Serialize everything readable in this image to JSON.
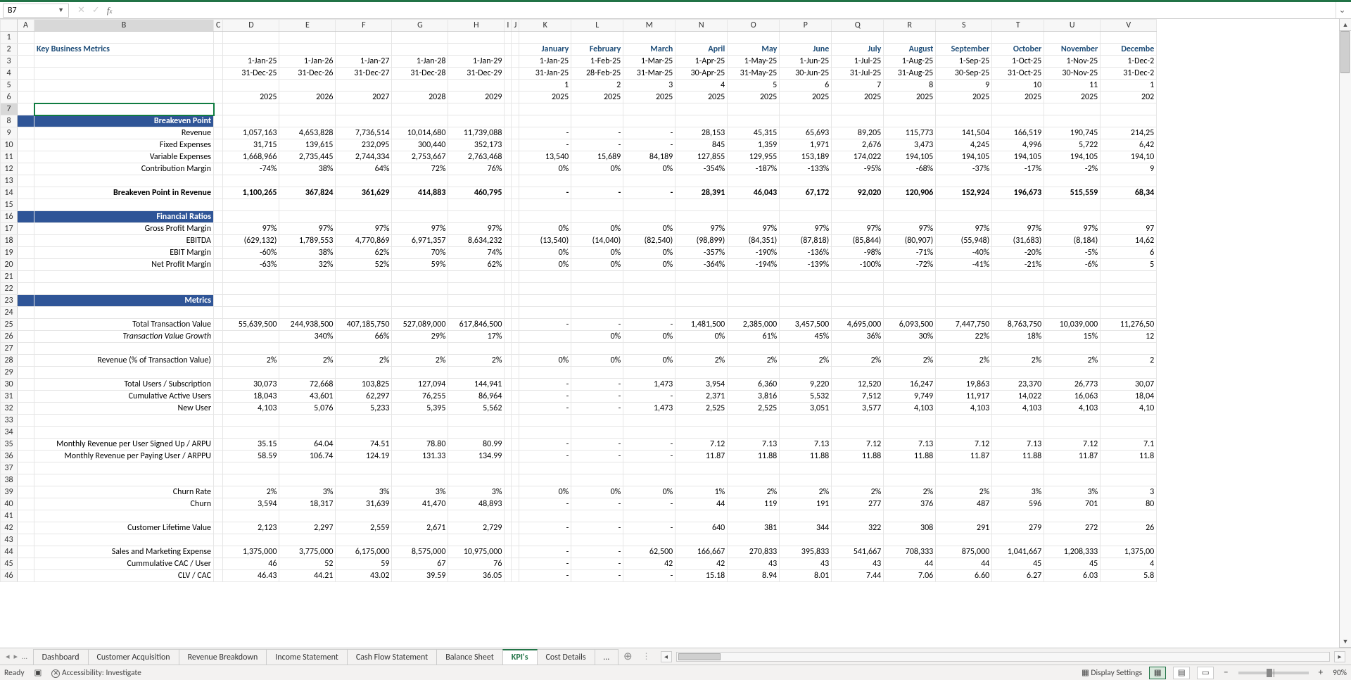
{
  "namebox": "B7",
  "columns": [
    "A",
    "B",
    "C",
    "D",
    "E",
    "F",
    "G",
    "H",
    "I",
    "J",
    "K",
    "L",
    "M",
    "N",
    "O",
    "P",
    "Q",
    "R",
    "S",
    "T",
    "U",
    "V"
  ],
  "colWidths": {
    "A": 24,
    "B": 255,
    "C": 5,
    "D": 80,
    "E": 80,
    "F": 80,
    "G": 80,
    "H": 80,
    "I": 6,
    "J": 6,
    "K": 74,
    "L": 74,
    "M": 74,
    "N": 74,
    "O": 74,
    "P": 74,
    "Q": 74,
    "R": 74,
    "S": 80,
    "T": 74,
    "U": 80,
    "V": 80
  },
  "title": "Key Business Metrics",
  "months": [
    "January",
    "February",
    "March",
    "April",
    "May",
    "June",
    "July",
    "August",
    "September",
    "October",
    "November",
    "Decembe"
  ],
  "row3": [
    "1-Jan-25",
    "1-Jan-26",
    "1-Jan-27",
    "1-Jan-28",
    "1-Jan-29",
    "",
    "",
    "1-Jan-25",
    "1-Feb-25",
    "1-Mar-25",
    "1-Apr-25",
    "1-May-25",
    "1-Jun-25",
    "1-Jul-25",
    "1-Aug-25",
    "1-Sep-25",
    "1-Oct-25",
    "1-Nov-25",
    "1-Dec-2"
  ],
  "row4": [
    "31-Dec-25",
    "31-Dec-26",
    "31-Dec-27",
    "31-Dec-28",
    "31-Dec-29",
    "",
    "",
    "31-Jan-25",
    "28-Feb-25",
    "31-Mar-25",
    "30-Apr-25",
    "31-May-25",
    "30-Jun-25",
    "31-Jul-25",
    "31-Aug-25",
    "30-Sep-25",
    "31-Oct-25",
    "30-Nov-25",
    "31-Dec-2"
  ],
  "row5": [
    "",
    "",
    "",
    "",
    "",
    "",
    "",
    "1",
    "2",
    "3",
    "4",
    "5",
    "6",
    "7",
    "8",
    "9",
    "10",
    "11",
    "1"
  ],
  "row6": [
    "2025",
    "2026",
    "2027",
    "2028",
    "2029",
    "",
    "",
    "2025",
    "2025",
    "2025",
    "2025",
    "2025",
    "2025",
    "2025",
    "2025",
    "2025",
    "2025",
    "2025",
    "202"
  ],
  "sections": [
    {
      "row": 8,
      "header": "Breakeven Point",
      "rows": [
        {
          "n": 9,
          "label": "Revenue",
          "d": [
            "1,057,163",
            "4,653,828",
            "7,736,514",
            "10,014,680",
            "11,739,088",
            "",
            "",
            "-",
            "-",
            "-",
            "28,153",
            "45,315",
            "65,693",
            "89,205",
            "115,773",
            "141,504",
            "166,519",
            "190,745",
            "214,25"
          ]
        },
        {
          "n": 10,
          "label": "Fixed Expenses",
          "d": [
            "31,715",
            "139,615",
            "232,095",
            "300,440",
            "352,173",
            "",
            "",
            "-",
            "-",
            "-",
            "845",
            "1,359",
            "1,971",
            "2,676",
            "3,473",
            "4,245",
            "4,996",
            "5,722",
            "6,42"
          ]
        },
        {
          "n": 11,
          "label": "Variable Expenses",
          "d": [
            "1,668,966",
            "2,735,445",
            "2,744,334",
            "2,753,667",
            "2,763,468",
            "",
            "",
            "13,540",
            "15,689",
            "84,189",
            "127,855",
            "129,955",
            "153,189",
            "174,022",
            "194,105",
            "194,105",
            "194,105",
            "194,105",
            "194,10"
          ]
        },
        {
          "n": 12,
          "label": "Contribution Margin",
          "d": [
            "-74%",
            "38%",
            "64%",
            "72%",
            "76%",
            "",
            "",
            "0%",
            "0%",
            "0%",
            "-354%",
            "-187%",
            "-133%",
            "-95%",
            "-68%",
            "-37%",
            "-17%",
            "-2%",
            "9"
          ]
        }
      ],
      "total": {
        "n": 14,
        "label": "Breakeven Point in Revenue",
        "d": [
          "1,100,265",
          "367,824",
          "361,629",
          "414,883",
          "460,795",
          "",
          "",
          "-",
          "-",
          "-",
          "28,391",
          "46,043",
          "67,172",
          "92,020",
          "120,906",
          "152,924",
          "196,673",
          "515,559",
          "68,34"
        ]
      }
    },
    {
      "row": 16,
      "header": "Financial Ratios",
      "rows": [
        {
          "n": 17,
          "label": "Gross Profit Margin",
          "d": [
            "97%",
            "97%",
            "97%",
            "97%",
            "97%",
            "",
            "",
            "0%",
            "0%",
            "0%",
            "97%",
            "97%",
            "97%",
            "97%",
            "97%",
            "97%",
            "97%",
            "97%",
            "97"
          ]
        },
        {
          "n": 18,
          "label": "EBITDA",
          "d": [
            "(629,132)",
            "1,789,553",
            "4,770,869",
            "6,971,357",
            "8,634,232",
            "",
            "",
            "(13,540)",
            "(14,040)",
            "(82,540)",
            "(98,899)",
            "(84,351)",
            "(87,818)",
            "(85,844)",
            "(80,907)",
            "(55,948)",
            "(31,683)",
            "(8,184)",
            "14,62"
          ]
        },
        {
          "n": 19,
          "label": "EBIT Margin",
          "d": [
            "-60%",
            "38%",
            "62%",
            "70%",
            "74%",
            "",
            "",
            "0%",
            "0%",
            "0%",
            "-357%",
            "-190%",
            "-136%",
            "-98%",
            "-71%",
            "-40%",
            "-20%",
            "-5%",
            "6"
          ]
        },
        {
          "n": 20,
          "label": "Net Profit Margin",
          "d": [
            "-63%",
            "32%",
            "52%",
            "59%",
            "62%",
            "",
            "",
            "0%",
            "0%",
            "0%",
            "-364%",
            "-194%",
            "-139%",
            "-100%",
            "-72%",
            "-41%",
            "-21%",
            "-6%",
            "5"
          ]
        }
      ]
    },
    {
      "row": 23,
      "header": "Metrics",
      "rows": [
        {
          "n": 25,
          "label": "Total Transaction Value",
          "d": [
            "55,639,500",
            "244,938,500",
            "407,185,750",
            "527,089,000",
            "617,846,500",
            "",
            "",
            "-",
            "-",
            "-",
            "1,481,500",
            "2,385,000",
            "3,457,500",
            "4,695,000",
            "6,093,500",
            "7,447,750",
            "8,763,750",
            "10,039,000",
            "11,276,50"
          ]
        },
        {
          "n": 26,
          "label": "Transaction Value Growth",
          "italic": true,
          "d": [
            "",
            "340%",
            "66%",
            "29%",
            "17%",
            "",
            "",
            "",
            "0%",
            "0%",
            "0%",
            "61%",
            "45%",
            "36%",
            "30%",
            "22%",
            "18%",
            "15%",
            "12"
          ]
        },
        {
          "n": 28,
          "label": "Revenue (% of Transaction Value)",
          "d": [
            "2%",
            "2%",
            "2%",
            "2%",
            "2%",
            "",
            "",
            "0%",
            "0%",
            "0%",
            "2%",
            "2%",
            "2%",
            "2%",
            "2%",
            "2%",
            "2%",
            "2%",
            "2"
          ]
        },
        {
          "n": 30,
          "label": "Total Users / Subscription",
          "d": [
            "30,073",
            "72,668",
            "103,825",
            "127,094",
            "144,941",
            "",
            "",
            "-",
            "-",
            "1,473",
            "3,954",
            "6,360",
            "9,220",
            "12,520",
            "16,247",
            "19,863",
            "23,370",
            "26,773",
            "30,07"
          ]
        },
        {
          "n": 31,
          "label": "Cumulative Active Users",
          "d": [
            "18,043",
            "43,601",
            "62,297",
            "76,255",
            "86,964",
            "",
            "",
            "-",
            "-",
            "-",
            "2,371",
            "3,816",
            "5,532",
            "7,512",
            "9,749",
            "11,917",
            "14,022",
            "16,063",
            "18,04"
          ]
        },
        {
          "n": 32,
          "label": "New User",
          "d": [
            "4,103",
            "5,076",
            "5,233",
            "5,395",
            "5,562",
            "",
            "",
            "-",
            "-",
            "1,473",
            "2,525",
            "2,525",
            "3,051",
            "3,577",
            "4,103",
            "4,103",
            "4,103",
            "4,103",
            "4,10"
          ]
        },
        {
          "n": 35,
          "label": "Monthly Revenue per User Signed Up / ARPU",
          "d": [
            "35.15",
            "64.04",
            "74.51",
            "78.80",
            "80.99",
            "",
            "",
            "-",
            "-",
            "-",
            "7.12",
            "7.13",
            "7.13",
            "7.12",
            "7.13",
            "7.12",
            "7.13",
            "7.12",
            "7.1"
          ]
        },
        {
          "n": 36,
          "label": "Monthly Revenue per Paying User / ARPPU",
          "d": [
            "58.59",
            "106.74",
            "124.19",
            "131.33",
            "134.99",
            "",
            "",
            "-",
            "-",
            "-",
            "11.87",
            "11.88",
            "11.88",
            "11.88",
            "11.88",
            "11.87",
            "11.88",
            "11.87",
            "11.8"
          ]
        },
        {
          "n": 39,
          "label": "Churn Rate",
          "d": [
            "2%",
            "3%",
            "3%",
            "3%",
            "3%",
            "",
            "",
            "0%",
            "0%",
            "0%",
            "1%",
            "2%",
            "2%",
            "2%",
            "2%",
            "2%",
            "3%",
            "3%",
            "3"
          ]
        },
        {
          "n": 40,
          "label": "Churn",
          "d": [
            "3,594",
            "18,317",
            "31,639",
            "41,470",
            "48,893",
            "",
            "",
            "-",
            "-",
            "-",
            "44",
            "119",
            "191",
            "277",
            "376",
            "487",
            "596",
            "701",
            "80"
          ]
        },
        {
          "n": 42,
          "label": "Customer Lifetime Value",
          "d": [
            "2,123",
            "2,297",
            "2,559",
            "2,671",
            "2,729",
            "",
            "",
            "-",
            "-",
            "-",
            "640",
            "381",
            "344",
            "322",
            "308",
            "291",
            "279",
            "272",
            "26"
          ]
        },
        {
          "n": 44,
          "label": "Sales and Marketing Expense",
          "d": [
            "1,375,000",
            "3,775,000",
            "6,175,000",
            "8,575,000",
            "10,975,000",
            "",
            "",
            "-",
            "-",
            "62,500",
            "166,667",
            "270,833",
            "395,833",
            "541,667",
            "708,333",
            "875,000",
            "1,041,667",
            "1,208,333",
            "1,375,00"
          ]
        },
        {
          "n": 45,
          "label": "Cummulative CAC / User",
          "d": [
            "46",
            "52",
            "59",
            "67",
            "76",
            "",
            "",
            "-",
            "-",
            "42",
            "42",
            "43",
            "43",
            "43",
            "44",
            "44",
            "45",
            "45",
            "4"
          ]
        },
        {
          "n": 46,
          "label": "CLV / CAC",
          "d": [
            "46.43",
            "44.21",
            "43.02",
            "39.59",
            "36.05",
            "",
            "",
            "-",
            "-",
            "-",
            "15.18",
            "8.94",
            "8.01",
            "7.44",
            "7.06",
            "6.60",
            "6.27",
            "6.03",
            "5.8"
          ]
        }
      ]
    }
  ],
  "blankRows": [
    1,
    7,
    13,
    15,
    21,
    22,
    24,
    27,
    29,
    33,
    34,
    37,
    38,
    41,
    43
  ],
  "hiddenRowsBreak": 37,
  "tabs": [
    {
      "label": "Dashboard",
      "active": false
    },
    {
      "label": "Customer Acquisition",
      "active": false
    },
    {
      "label": "Revenue Breakdown",
      "active": false
    },
    {
      "label": "Income Statement",
      "active": false
    },
    {
      "label": "Cash Flow Statement",
      "active": false
    },
    {
      "label": "Balance Sheet",
      "active": false
    },
    {
      "label": "KPI's",
      "active": true
    },
    {
      "label": "Cost Details",
      "active": false
    },
    {
      "label": "…",
      "active": false
    }
  ],
  "status": {
    "mode": "Ready",
    "accessibility": "Accessibility: Investigate",
    "display": "Display Settings",
    "zoom": "90%"
  }
}
